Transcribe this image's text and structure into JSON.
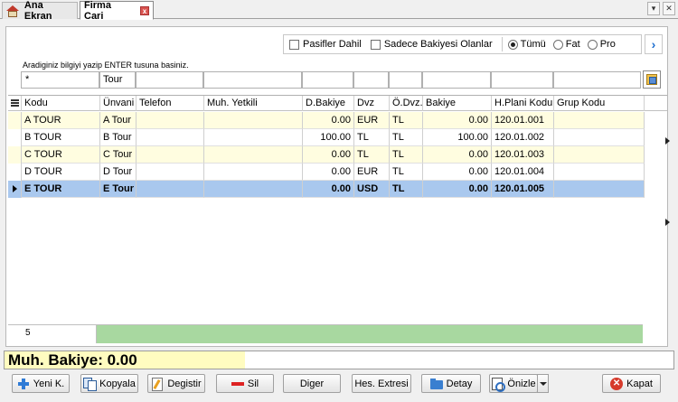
{
  "tabs": {
    "home_label": "Ana Ekran",
    "firma_label": "Firma Cari",
    "close_glyph": "x"
  },
  "window": {
    "dropdown_glyph": "▾",
    "close_glyph": "✕"
  },
  "filters": {
    "pasifler_label": "Pasifler Dahil",
    "sadece_label": "Sadece Bakiyesi Olanlar",
    "radios": [
      "Tümü",
      "Fat",
      "Pro"
    ],
    "selected_radio": "Tümü",
    "next_glyph": "›"
  },
  "hint": "Aradiginiz bilgiyi yazip ENTER tusuna basiniz.",
  "filter_row": [
    "*",
    "Tour",
    "",
    "",
    "",
    "",
    "",
    "",
    "",
    "",
    ""
  ],
  "columns": [
    "Kodu",
    "Ünvani",
    "Telefon",
    "Muh. Yetkili",
    "D.Bakiye",
    "Dvz",
    "Ö.Dvz.",
    "Bakiye",
    "H.Plani Kodu",
    "Grup Kodu"
  ],
  "rows": [
    [
      "A TOUR",
      "A Tour",
      "",
      "",
      "0.00",
      "EUR",
      "TL",
      "0.00",
      "120.01.001",
      ""
    ],
    [
      "B TOUR",
      "B Tour",
      "",
      "",
      "100.00",
      "TL",
      "TL",
      "100.00",
      "120.01.002",
      ""
    ],
    [
      "C TOUR",
      "C Tour",
      "",
      "",
      "0.00",
      "TL",
      "TL",
      "0.00",
      "120.01.003",
      ""
    ],
    [
      "D TOUR",
      "D Tour",
      "",
      "",
      "0.00",
      "EUR",
      "TL",
      "0.00",
      "120.01.004",
      ""
    ],
    [
      "E TOUR",
      "E Tour",
      "",
      "",
      "0.00",
      "USD",
      "TL",
      "0.00",
      "120.01.005",
      ""
    ]
  ],
  "selected_row": 4,
  "footer": {
    "count": "5"
  },
  "summary": {
    "label": "Muh. Bakiye: 0.00"
  },
  "buttons": {
    "yeni": "Yeni K.",
    "kopyala": "Kopyala",
    "degistir": "Degistir",
    "sil": "Sil",
    "diger": "Diger",
    "hes_extresi": "Hes. Extresi",
    "detay": "Detay",
    "onizle": "Önizle",
    "kapat": "Kapat"
  },
  "colors": {
    "row_alt": "#fffde0",
    "row_selected": "#a9c8ee",
    "footer_green": "#a8d8a0",
    "summary_yellow": "#fffcc0"
  }
}
